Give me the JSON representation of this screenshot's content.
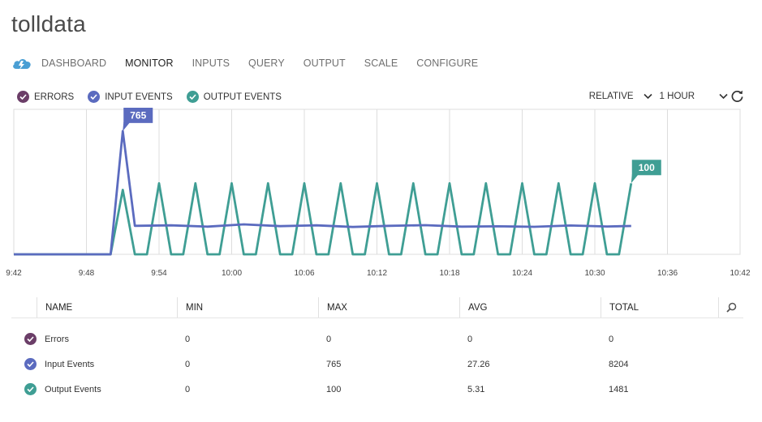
{
  "app": {
    "title": "tolldata"
  },
  "nav": {
    "tabs": [
      {
        "label": "DASHBOARD",
        "active": false
      },
      {
        "label": "MONITOR",
        "active": true
      },
      {
        "label": "INPUTS",
        "active": false
      },
      {
        "label": "QUERY",
        "active": false
      },
      {
        "label": "OUTPUT",
        "active": false
      },
      {
        "label": "SCALE",
        "active": false
      },
      {
        "label": "CONFIGURE",
        "active": false
      }
    ]
  },
  "colors": {
    "errors": "#6b3e68",
    "input_events": "#5b6bbf",
    "output_events": "#3f9e94",
    "cloud_icon": "#4a9fd4",
    "grid": "#dddddd"
  },
  "legend": {
    "errors": "ERRORS",
    "input_events": "INPUT EVENTS",
    "output_events": "OUTPUT EVENTS"
  },
  "controls": {
    "range_mode": "RELATIVE",
    "range_span": "1 HOUR"
  },
  "chart_data": {
    "type": "line",
    "x_ticks": [
      "9:42",
      "9:48",
      "9:54",
      "10:00",
      "10:06",
      "10:12",
      "10:18",
      "10:24",
      "10:30",
      "10:36",
      "10:42"
    ],
    "grid": true,
    "series": [
      {
        "name": "INPUT EVENTS",
        "x": [
          "9:42",
          "9:50",
          "9:51",
          "9:52",
          "9:55",
          "9:58",
          "10:01",
          "10:04",
          "10:07",
          "10:10",
          "10:13",
          "10:16",
          "10:19",
          "10:22",
          "10:25",
          "10:28",
          "10:31",
          "10:33"
        ],
        "values": [
          0,
          0,
          765,
          177,
          180,
          172,
          186,
          175,
          180,
          170,
          177,
          181,
          172,
          174,
          171,
          179,
          173,
          176
        ],
        "callout": "765"
      },
      {
        "name": "OUTPUT EVENTS",
        "x": [
          "9:42",
          "9:50",
          "9:51",
          "9:52",
          "9:53",
          "9:54",
          "9:55",
          "9:56",
          "9:57",
          "9:58",
          "9:59",
          "10:00",
          "10:01",
          "10:02",
          "10:03",
          "10:04",
          "10:05",
          "10:06",
          "10:07",
          "10:08",
          "10:09",
          "10:10",
          "10:11",
          "10:12",
          "10:13",
          "10:14",
          "10:15",
          "10:16",
          "10:17",
          "10:18",
          "10:19",
          "10:20",
          "10:21",
          "10:22",
          "10:23",
          "10:24",
          "10:25",
          "10:26",
          "10:27",
          "10:28",
          "10:29",
          "10:30",
          "10:31",
          "10:32",
          "10:33"
        ],
        "values": [
          0,
          0,
          400,
          0,
          0,
          441,
          0,
          0,
          441,
          0,
          0,
          441,
          0,
          0,
          441,
          0,
          0,
          441,
          0,
          0,
          441,
          0,
          0,
          441,
          0,
          0,
          441,
          0,
          0,
          441,
          0,
          0,
          441,
          0,
          0,
          441,
          0,
          0,
          441,
          0,
          0,
          441,
          0,
          0,
          441
        ],
        "callout": "100"
      }
    ]
  },
  "table": {
    "headers": {
      "name": "NAME",
      "min": "MIN",
      "max": "MAX",
      "avg": "AVG",
      "total": "TOTAL"
    },
    "rows": [
      {
        "key": "errors",
        "name": "Errors",
        "min": "0",
        "max": "0",
        "avg": "0",
        "total": "0"
      },
      {
        "key": "input_events",
        "name": "Input Events",
        "min": "0",
        "max": "765",
        "avg": "27.26",
        "total": "8204"
      },
      {
        "key": "output_events",
        "name": "Output Events",
        "min": "0",
        "max": "100",
        "avg": "5.31",
        "total": "1481"
      }
    ]
  }
}
